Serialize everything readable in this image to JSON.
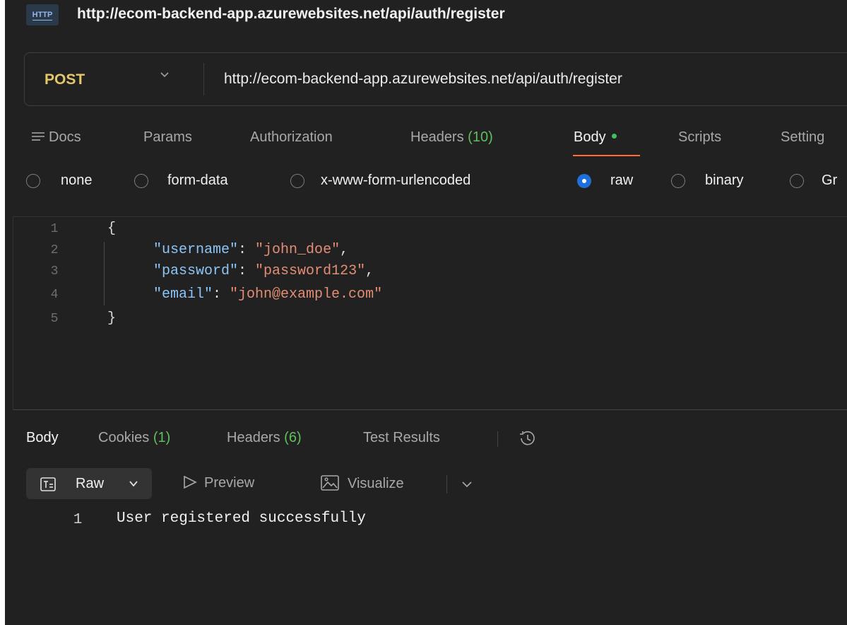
{
  "titlebar": {
    "icon_label": "HTTP",
    "url": "http://ecom-backend-app.azurewebsites.net/api/auth/register"
  },
  "request": {
    "method": "POST",
    "url": "http://ecom-backend-app.azurewebsites.net/api/auth/register",
    "tabs": [
      {
        "label": "Docs",
        "icon": "docs-icon"
      },
      {
        "label": "Params"
      },
      {
        "label": "Authorization"
      },
      {
        "label": "Headers",
        "count": "(10)"
      },
      {
        "label": "Body",
        "active": true,
        "indicator": "green-dot"
      },
      {
        "label": "Scripts"
      },
      {
        "label": "Setting"
      }
    ],
    "body_types": [
      {
        "label": "none",
        "checked": false
      },
      {
        "label": "form-data",
        "checked": false
      },
      {
        "label": "x-www-form-urlencoded",
        "checked": false
      },
      {
        "label": "raw",
        "checked": true
      },
      {
        "label": "binary",
        "checked": false
      },
      {
        "label": "Gr",
        "checked": false
      }
    ],
    "editor": {
      "lines": [
        {
          "num": "1",
          "text": "{"
        },
        {
          "num": "2",
          "key": "\"username\"",
          "sep": ": ",
          "value": "\"john_doe\"",
          "tail": ","
        },
        {
          "num": "3",
          "key": "\"password\"",
          "sep": ": ",
          "value": "\"password123\"",
          "tail": ","
        },
        {
          "num": "4",
          "key": "\"email\"",
          "sep": ": ",
          "value": "\"john@example.com\"",
          "tail": ""
        },
        {
          "num": "5",
          "text": "}"
        }
      ]
    }
  },
  "response": {
    "tabs": [
      {
        "label": "Body",
        "active": true
      },
      {
        "label": "Cookies",
        "count": "(1)"
      },
      {
        "label": "Headers",
        "count": "(6)"
      },
      {
        "label": "Test Results"
      }
    ],
    "history_icon": "history-icon",
    "format": {
      "label": "Raw"
    },
    "preview_label": "Preview",
    "visualize_label": "Visualize",
    "lines": [
      {
        "num": "1",
        "text": "User registered successfully"
      }
    ]
  },
  "colors": {
    "background": "#212121",
    "method": "#e3c869",
    "active_tab_underline": "#ff6c37",
    "count_green": "#5fbf5f",
    "radio_checked": "#1e6fd9",
    "json_key": "#8cc4f6",
    "json_string": "#e38d74"
  }
}
